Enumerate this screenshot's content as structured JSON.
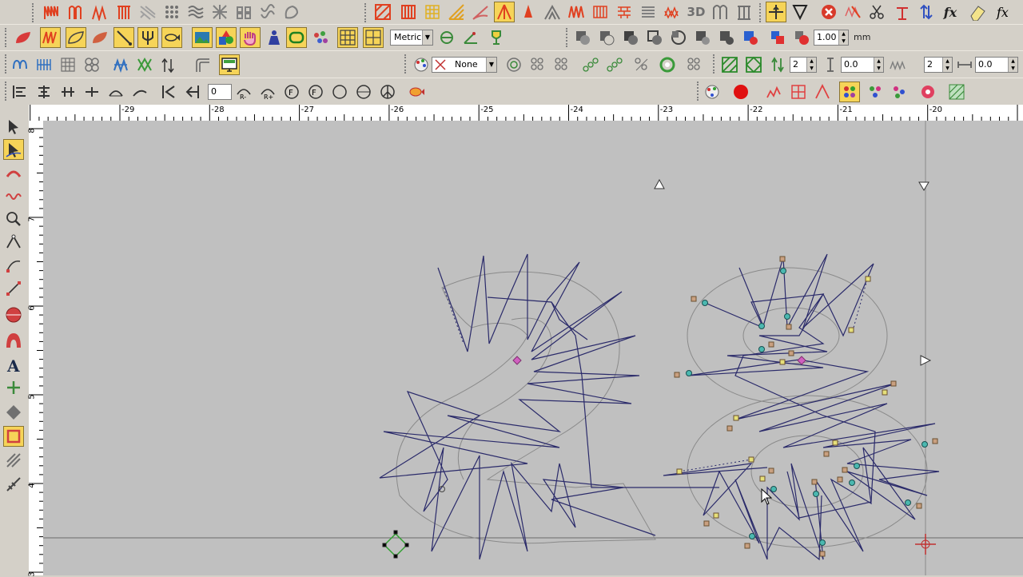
{
  "toolbar": {
    "units_select": "Metric",
    "pattern_select": "None",
    "zoom_value": "1.00",
    "zoom_unit": "mm",
    "spin_count_a": "2",
    "spin_value_a": "0.0",
    "spin_count_b": "2",
    "spin_value_b": "0.0",
    "stitch_length": "0",
    "label_3d": "3D",
    "label_fx": "fx"
  },
  "ruler": {
    "top_labels": [
      "-29",
      "-28",
      "-27",
      "-26",
      "-25",
      "-24",
      "-23",
      "-22",
      "-21",
      "-20"
    ],
    "left_labels": [
      "8",
      "7",
      "6",
      "5",
      "4",
      "3"
    ]
  },
  "colors": {
    "toolbar_bg": "#d4d0c8",
    "canvas_bg": "#c0c0c0",
    "stitch_line": "#2a2a6a",
    "outline": "#8a8a8a",
    "node_square": "#e6e07a",
    "node_circle": "#4bb8b0",
    "active_button": "#f6d458"
  },
  "canvas": {
    "digits": "23"
  }
}
